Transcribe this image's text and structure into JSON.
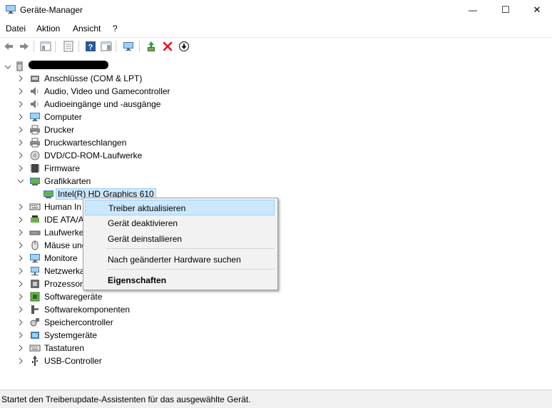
{
  "window": {
    "title": "Geräte-Manager",
    "minimize": "—",
    "maximize": "☐",
    "close": "✕"
  },
  "menu": [
    "Datei",
    "Aktion",
    "Ansicht",
    "?"
  ],
  "toolbar": {
    "buttons": [
      "back-icon",
      "forward-icon",
      "show-hide-console-tree-icon",
      "properties-icon",
      "help-icon",
      "action-pane-icon",
      "scan-hardware-icon",
      "update-driver-icon",
      "uninstall-icon",
      "disable-icon"
    ]
  },
  "tree": {
    "categories": [
      {
        "label": "Anschlüsse (COM & LPT)",
        "icon": "port-icon"
      },
      {
        "label": "Audio, Video und Gamecontroller",
        "icon": "speaker-icon"
      },
      {
        "label": "Audioeingänge und -ausgänge",
        "icon": "speaker-icon"
      },
      {
        "label": "Computer",
        "icon": "monitor-icon"
      },
      {
        "label": "Drucker",
        "icon": "printer-icon"
      },
      {
        "label": "Druckwarteschlangen",
        "icon": "printer-icon"
      },
      {
        "label": "DVD/CD-ROM-Laufwerke",
        "icon": "disc-icon"
      },
      {
        "label": "Firmware",
        "icon": "chip-icon"
      },
      {
        "label": "Grafikkarten",
        "icon": "display-adapter-icon"
      },
      {
        "label": "Intel(R) HD Graphics 610",
        "icon": "display-adapter-icon"
      },
      {
        "label": "Human In",
        "icon": "keyboard-icon"
      },
      {
        "label": "IDE ATA/A",
        "icon": "ide-icon"
      },
      {
        "label": "Laufwerke",
        "icon": "drive-icon"
      },
      {
        "label": "Mäuse und",
        "icon": "mouse-icon"
      },
      {
        "label": "Monitore",
        "icon": "monitor-icon"
      },
      {
        "label": "Netzwerka",
        "icon": "network-icon"
      },
      {
        "label": "Prozessore",
        "icon": "processor-icon"
      },
      {
        "label": "Softwaregeräte",
        "icon": "software-device-icon"
      },
      {
        "label": "Softwarekomponenten",
        "icon": "software-component-icon"
      },
      {
        "label": "Speichercontroller",
        "icon": "storage-controller-icon"
      },
      {
        "label": "Systemgeräte",
        "icon": "system-device-icon"
      },
      {
        "label": "Tastaturen",
        "icon": "keyboard-icon"
      },
      {
        "label": "USB-Controller",
        "icon": "usb-icon"
      }
    ]
  },
  "context_menu": {
    "items": [
      "Treiber aktualisieren",
      "Gerät deaktivieren",
      "Gerät deinstallieren",
      "Nach geänderter Hardware suchen",
      "Eigenschaften"
    ]
  },
  "status": "Startet den Treiberupdate-Assistenten für das ausgewählte Gerät.",
  "colors": {
    "highlight": "#cce8ff",
    "highlight_border": "#99d1ff",
    "accent_red": "#e81123",
    "help_blue": "#2b5797"
  }
}
